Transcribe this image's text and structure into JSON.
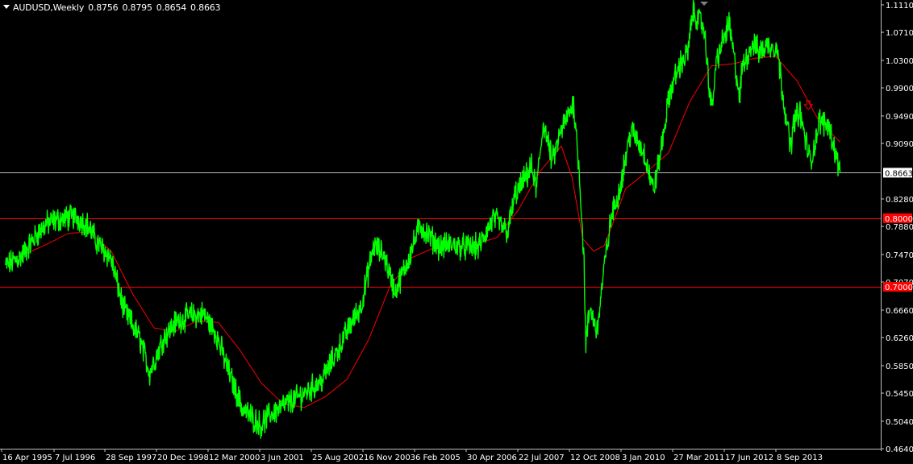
{
  "chart_header": {
    "symbol": "AUDUSD,Weekly",
    "open": "0.8756",
    "high": "0.8795",
    "low": "0.8654",
    "close": "0.8663"
  },
  "chart_data": {
    "type": "line",
    "title": "",
    "x_tick_labels": [
      "16 Apr 1995",
      "7 Jul 1996",
      "28 Sep 1997",
      "20 Dec 1998",
      "12 Mar 2000",
      "3 Jun 2001",
      "25 Aug 2002",
      "16 Nov 2003",
      "6 Feb 2005",
      "30 Apr 2006",
      "22 Jul 2007",
      "12 Oct 2008",
      "3 Jan 2010",
      "27 Mar 2011",
      "17 Jun 2012",
      "8 Sep 2013"
    ],
    "y_tick_labels": [
      "1.1110",
      "1.0710",
      "1.0300",
      "0.9900",
      "0.9490",
      "0.9090",
      "0.8280",
      "0.7880",
      "0.7470",
      "0.7070",
      "0.6660",
      "0.6260",
      "0.5850",
      "0.5450",
      "0.5040",
      "0.4640"
    ],
    "ylim": [
      0.464,
      1.111
    ],
    "grid": false,
    "current_price": {
      "label": "0.8663",
      "value": 0.8663,
      "color": "#c0c0c0"
    },
    "horizontal_lines": [
      {
        "label": "0.8000",
        "value": 0.8,
        "color": "#ff0000"
      },
      {
        "label": "0.7000",
        "value": 0.7,
        "color": "#ff0000"
      }
    ],
    "series": [
      {
        "style": "price",
        "color": "#00ff00",
        "x": [
          "1995-04-16",
          "1995-09-01",
          "1996-01-15",
          "1996-04-01",
          "1996-07-07",
          "1996-12-01",
          "1997-03-15",
          "1997-06-01",
          "1997-09-28",
          "1998-01-15",
          "1998-06-01",
          "1998-08-25",
          "1998-12-20",
          "1999-04-01",
          "1999-08-01",
          "1999-12-01",
          "2000-03-12",
          "2000-07-01",
          "2000-10-25",
          "2001-04-01",
          "2001-06-03",
          "2001-10-01",
          "2002-03-01",
          "2002-08-25",
          "2003-01-15",
          "2003-05-01",
          "2003-08-01",
          "2003-11-16",
          "2004-02-15",
          "2004-05-15",
          "2004-09-01",
          "2004-12-15",
          "2005-02-06",
          "2005-06-01",
          "2005-09-01",
          "2005-12-15",
          "2006-04-30",
          "2006-09-01",
          "2007-01-01",
          "2007-03-01",
          "2007-07-22",
          "2007-09-01",
          "2007-11-01",
          "2008-01-15",
          "2008-04-01",
          "2008-07-15",
          "2008-09-01",
          "2008-10-12",
          "2008-10-27",
          "2008-12-01",
          "2009-01-30",
          "2009-04-01",
          "2009-06-01",
          "2009-08-01",
          "2009-11-15",
          "2010-01-03",
          "2010-03-15",
          "2010-05-25",
          "2010-07-15",
          "2010-10-15",
          "2010-12-30",
          "2011-03-15",
          "2011-04-27",
          "2011-07-28",
          "2011-10-04",
          "2011-11-15",
          "2012-02-29",
          "2012-06-01",
          "2012-06-17",
          "2012-09-15",
          "2012-11-15",
          "2013-01-15",
          "2013-04-11",
          "2013-06-01",
          "2013-08-05",
          "2013-09-08",
          "2013-10-22",
          "2014-01-24",
          "2014-04-10",
          "2014-07-01",
          "2014-09-01",
          "2014-10-01"
        ],
        "values": [
          0.73,
          0.745,
          0.778,
          0.792,
          0.798,
          0.802,
          0.79,
          0.765,
          0.742,
          0.668,
          0.625,
          0.575,
          0.625,
          0.648,
          0.658,
          0.66,
          0.632,
          0.575,
          0.522,
          0.498,
          0.512,
          0.526,
          0.541,
          0.562,
          0.608,
          0.645,
          0.672,
          0.76,
          0.745,
          0.692,
          0.738,
          0.79,
          0.778,
          0.758,
          0.762,
          0.758,
          0.758,
          0.8,
          0.78,
          0.832,
          0.874,
          0.842,
          0.94,
          0.882,
          0.928,
          0.968,
          0.87,
          0.735,
          0.615,
          0.67,
          0.635,
          0.728,
          0.802,
          0.835,
          0.928,
          0.915,
          0.892,
          0.84,
          0.885,
          0.985,
          1.021,
          1.042,
          1.1,
          1.08,
          0.957,
          1.03,
          1.085,
          0.972,
          1.018,
          1.055,
          1.042,
          1.052,
          1.05,
          0.982,
          0.902,
          0.945,
          0.955,
          0.88,
          0.942,
          0.935,
          0.889,
          0.866
        ]
      },
      {
        "style": "moving average",
        "color": "#ff0000",
        "x": [
          "1995-04-16",
          "1995-10-01",
          "1996-04-01",
          "1996-10-01",
          "1997-04-01",
          "1997-10-01",
          "1998-04-01",
          "1998-10-01",
          "1999-04-01",
          "1999-10-01",
          "2000-04-01",
          "2000-10-01",
          "2001-04-01",
          "2001-10-01",
          "2002-04-01",
          "2002-10-01",
          "2003-04-01",
          "2003-10-01",
          "2004-04-01",
          "2004-10-01",
          "2005-04-01",
          "2005-10-01",
          "2006-04-01",
          "2006-10-01",
          "2007-04-01",
          "2007-10-01",
          "2008-04-01",
          "2008-07-01",
          "2008-10-01",
          "2009-01-01",
          "2009-04-01",
          "2009-07-01",
          "2009-10-01",
          "2010-04-01",
          "2010-10-01",
          "2011-04-01",
          "2011-10-01",
          "2012-04-01",
          "2012-10-01",
          "2013-04-01",
          "2013-10-01",
          "2014-04-01",
          "2014-10-01"
        ],
        "values": [
          0.738,
          0.748,
          0.762,
          0.778,
          0.78,
          0.752,
          0.69,
          0.64,
          0.635,
          0.65,
          0.648,
          0.608,
          0.56,
          0.53,
          0.524,
          0.54,
          0.565,
          0.622,
          0.7,
          0.742,
          0.756,
          0.758,
          0.762,
          0.772,
          0.812,
          0.868,
          0.905,
          0.86,
          0.77,
          0.752,
          0.76,
          0.8,
          0.843,
          0.868,
          0.895,
          0.97,
          1.022,
          1.025,
          1.033,
          1.036,
          1.0,
          0.943,
          0.911
        ]
      }
    ],
    "annotations": [
      {
        "type": "arrow-down",
        "color": "#ff0000",
        "x": "2014-01-05",
        "value": 0.962
      }
    ]
  }
}
